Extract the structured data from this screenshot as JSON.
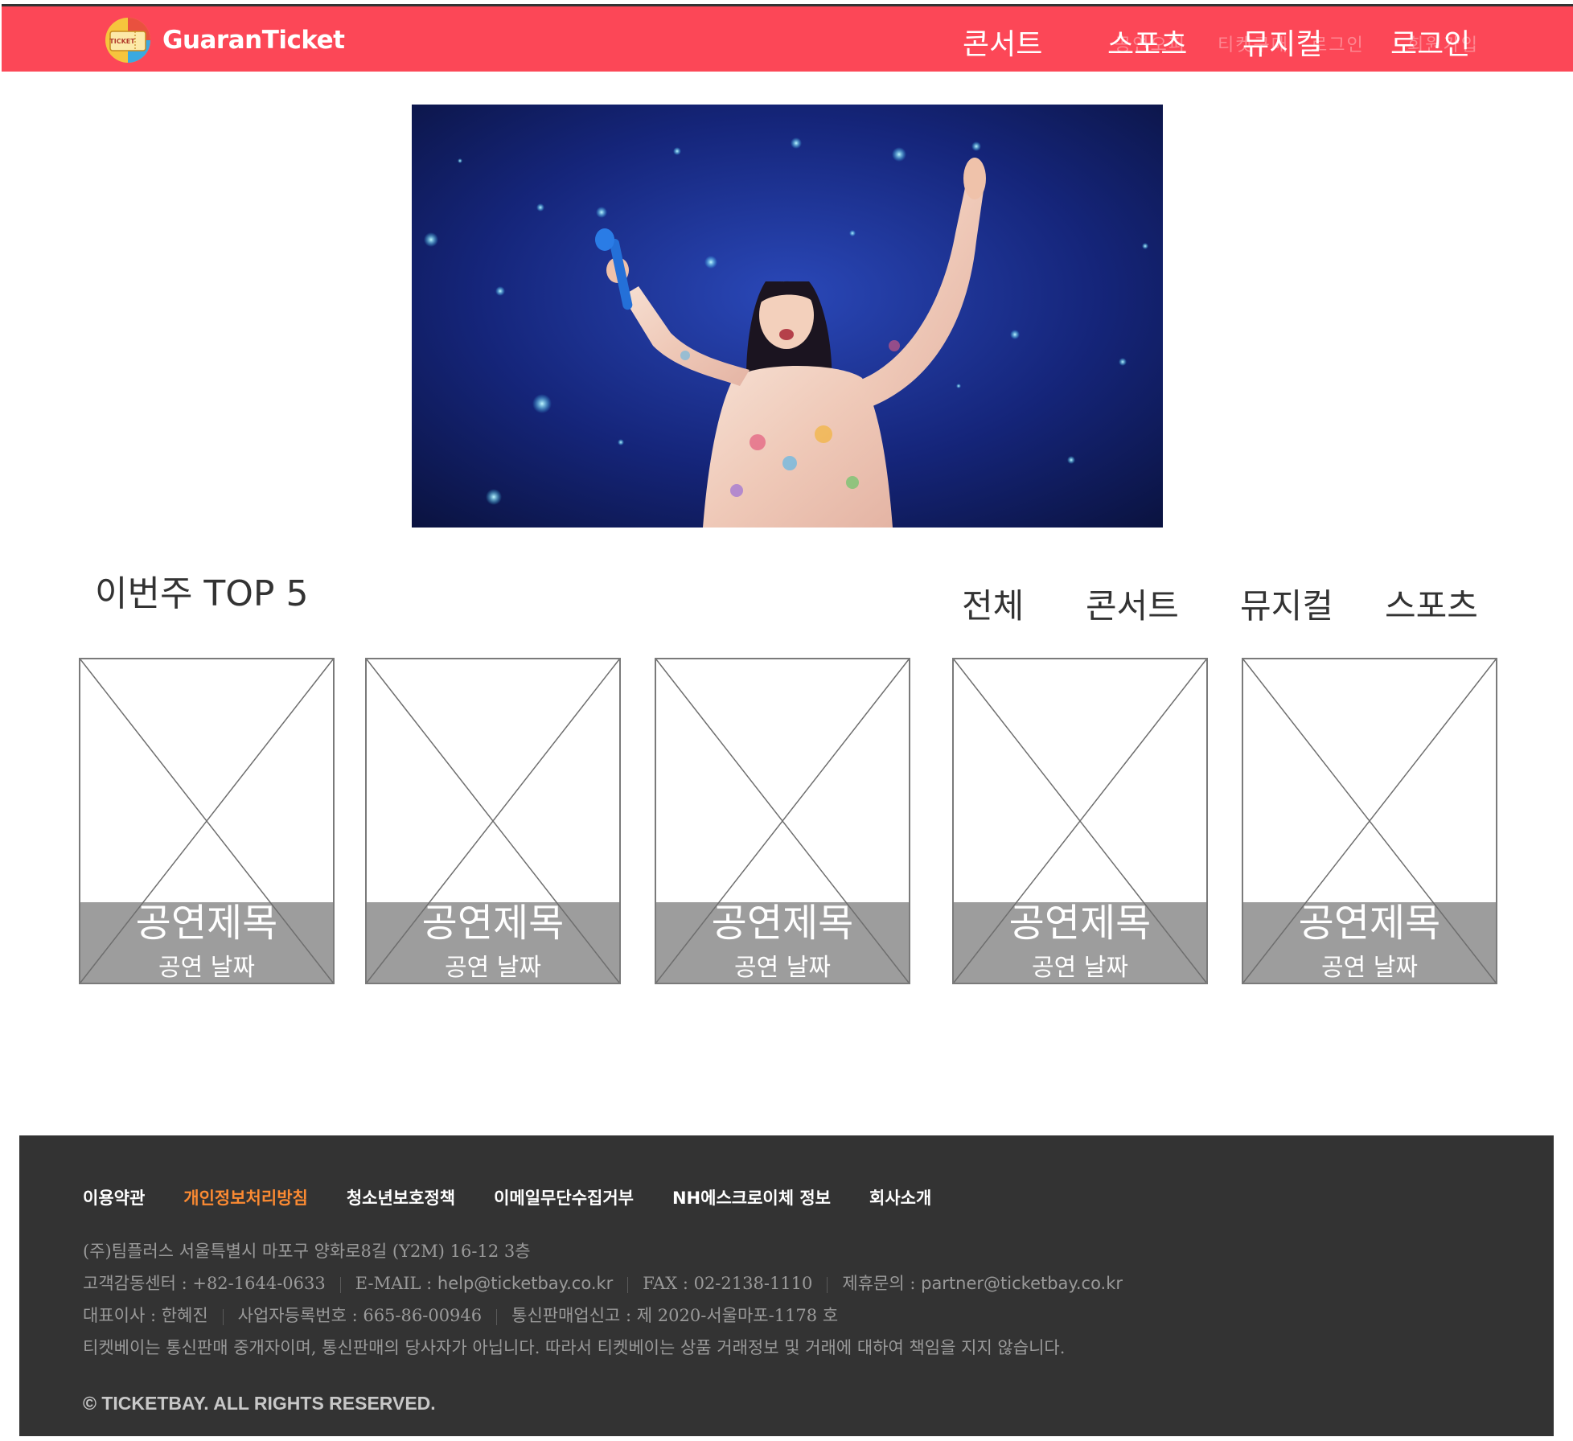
{
  "header": {
    "logo_text": "GuaranTicket",
    "logo_badge_text": "TICKET",
    "nav": [
      "콘서트",
      "스포츠",
      "뮤지컬",
      "로그인"
    ],
    "ghost_nav": [
      "공연오피",
      "티켓구매",
      "로그인",
      "회원가입"
    ]
  },
  "hero": {
    "alt": "concert performer on stage"
  },
  "top5": {
    "title": "이번주 TOP 5",
    "filters": [
      "전체",
      "콘서트",
      "뮤지컬",
      "스포츠"
    ],
    "cards": [
      {
        "title": "공연제목",
        "date": "공연 날짜"
      },
      {
        "title": "공연제목",
        "date": "공연 날짜"
      },
      {
        "title": "공연제목",
        "date": "공연 날짜"
      },
      {
        "title": "공연제목",
        "date": "공연 날짜"
      },
      {
        "title": "공연제목",
        "date": "공연 날짜"
      }
    ]
  },
  "footer": {
    "links": [
      "이용약관",
      "개인정보처리방침",
      "청소년보호정책",
      "이메일무단수집거부",
      "NH에스크로이체 정보",
      "회사소개"
    ],
    "address": "(주)팀플러스 서울특별시 마포구 양화로8길 (Y2M) 16-12 3층",
    "line2": {
      "cs": "고객감동센터 : +82-1644-0633",
      "email_label": "E-MAIL : ",
      "email": "help@ticketbay.co.kr",
      "fax": "FAX : 02-2138-1110",
      "partner_label": "제휴문의 : ",
      "partner": "partner@ticketbay.co.kr"
    },
    "line3": {
      "ceo": "대표이사 : 한혜진",
      "business_no": "사업자등록번호 : 665-86-00946",
      "mail_order": "통신판매업신고 : 제 2020-서울마포-1178 호"
    },
    "disclaimer": "티켓베이는 통신판매 중개자이며, 통신판매의 당사자가 아닙니다. 따라서 티켓베이는 상품 거래정보 및 거래에 대하여 책임을 지지 않습니다.",
    "copyright": "© TICKETBAY. ALL RIGHTS RESERVED."
  },
  "colors": {
    "header_bg": "#fc4757",
    "footer_bg": "#333333",
    "footer_highlight": "#fb8a32",
    "card_caption_bg": "#8c8c8c"
  }
}
